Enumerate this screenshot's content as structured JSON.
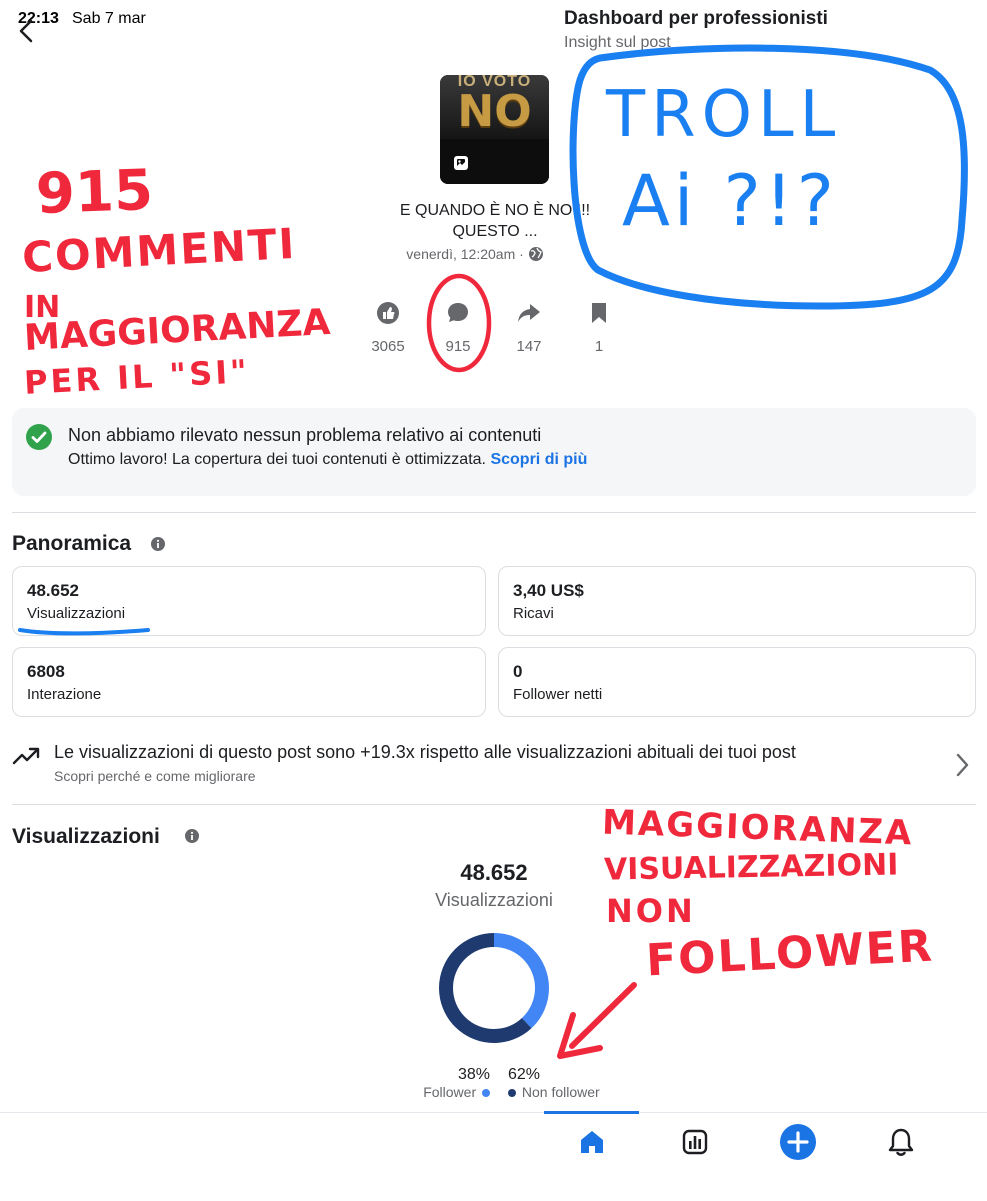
{
  "status_bar": {
    "time": "22:13",
    "date": "Sab 7 mar"
  },
  "header": {
    "title": "Dashboard per professionisti",
    "subtitle": "Insight sul post"
  },
  "post": {
    "thumbnail_text_top": "IO VOTO",
    "thumbnail_text_main": "NO",
    "title_line1": "E QUANDO È NO È NO !!!",
    "title_line2": "QUESTO ...",
    "date": "venerdì, 12:20am"
  },
  "stats": {
    "reactions": "3065",
    "comments": "915",
    "shares": "147",
    "saves": "1"
  },
  "notice": {
    "title": "Non abbiamo rilevato nessun problema relativo ai contenuti",
    "text": "Ottimo lavoro! La copertura dei tuoi contenuti è ottimizzata.",
    "link": "Scopri di più"
  },
  "overview": {
    "title": "Panoramica",
    "cards": [
      {
        "value": "48.652",
        "label": "Visualizzazioni"
      },
      {
        "value": "3,40 US$",
        "label": "Ricavi"
      },
      {
        "value": "6808",
        "label": "Interazione"
      },
      {
        "value": "0",
        "label": "Follower netti"
      }
    ]
  },
  "insight": {
    "main": "Le visualizzazioni di questo post sono +19.3x rispetto alle visualizzazioni abituali dei tuoi post",
    "sub": "Scopri perché e come migliorare"
  },
  "views": {
    "title": "Visualizzazioni",
    "total": "48.652",
    "caption": "Visualizzazioni",
    "legend": [
      {
        "percent": "38%",
        "label": "Follower",
        "color": "#4285f4"
      },
      {
        "percent": "62%",
        "label": "Non follower",
        "color": "#1f3a6e"
      }
    ]
  },
  "chart_data": {
    "type": "pie",
    "categories": [
      "Follower",
      "Non follower"
    ],
    "values": [
      38,
      62
    ],
    "colors": [
      "#4285f4",
      "#1f3a6e"
    ],
    "title": "Visualizzazioni"
  },
  "annotations": {
    "red_left_1": "915",
    "red_left_2": "COMMENTI",
    "red_left_3": "IN",
    "red_left_4": "MAGGIORANZA",
    "red_left_5": "PER IL \"SI\"",
    "blue_box_1": "TROLL",
    "blue_box_2": "Ai ?!?",
    "red_right_1": "MAGGIORANZA",
    "red_right_2": "VISUALIZZAZIONI",
    "red_right_3": "NON",
    "red_right_4": "FOLLOWER"
  },
  "colors": {
    "accent": "#1b74e4",
    "annotation_red": "#f0283c",
    "annotation_blue": "#1a7ff0",
    "success": "#31a24c"
  },
  "tabbar": {
    "items": [
      "home-icon",
      "insights-icon",
      "create-icon",
      "notifications-icon"
    ],
    "active": "home-icon"
  }
}
